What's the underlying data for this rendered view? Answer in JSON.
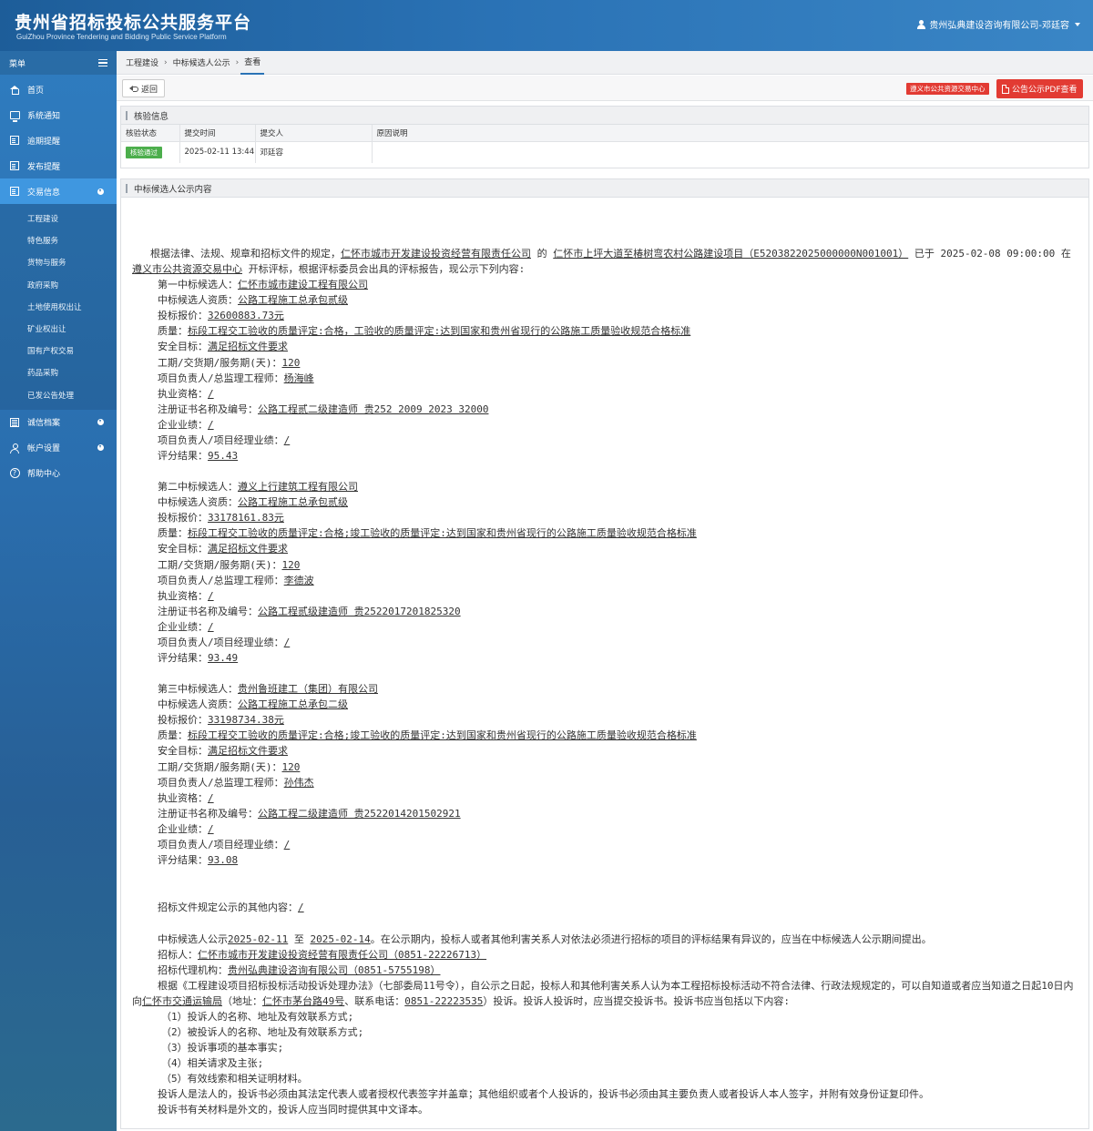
{
  "header": {
    "title": "贵州省招标投标公共服务平台",
    "subtitle": "GuiZhou Province Tendering and Bidding Public Service Platform",
    "user": "贵州弘典建设咨询有限公司-邓廷容"
  },
  "sidebar": {
    "menu_label": "菜单",
    "items": [
      {
        "label": "首页",
        "icon": "home-icon"
      },
      {
        "label": "系统通知",
        "icon": "monitor-icon"
      },
      {
        "label": "逾期提醒",
        "icon": "document-icon"
      },
      {
        "label": "发布提醒",
        "icon": "document-icon"
      },
      {
        "label": "交易信息",
        "icon": "document-icon"
      }
    ],
    "sub_items": [
      "工程建设",
      "特色服务",
      "货物与服务",
      "政府采购",
      "土地使用权出让",
      "矿业权出让",
      "国有产权交易",
      "药品采购",
      "已发公告处理"
    ],
    "lower_items": [
      {
        "label": "诚信档案",
        "icon": "list-icon"
      },
      {
        "label": "帐户设置",
        "icon": "person-icon"
      },
      {
        "label": "帮助中心",
        "icon": "help-icon"
      }
    ]
  },
  "breadcrumb": [
    "工程建设",
    "中标候选人公示",
    "查看"
  ],
  "toolbar": {
    "back_label": "返回",
    "center_label": "遵义市公共资源交易中心",
    "pdf_label": "公告公示PDF查看"
  },
  "verify": {
    "title": "核验信息",
    "columns": [
      "核验状态",
      "提交时间",
      "提交人",
      "原因说明"
    ],
    "row": {
      "status": "核验通过",
      "time": "2025-02-11 13:44",
      "submitter": "邓廷容",
      "reason": ""
    }
  },
  "notice": {
    "title": "中标候选人公示内容",
    "intro_a": "根据法律、法规、规章和招标文件的规定，",
    "tenderer": "仁怀市城市开发建设投资经营有限责任公司",
    "intro_b": "的",
    "project": "仁怀市上坪大道至椿树弯农村公路建设项目（E5203822025000000N001001）",
    "intro_c": "已于",
    "open_time": "2025-02-08 09:00:00",
    "intro_d": "在",
    "venue": "遵义市公共资源交易中心",
    "intro_e": "开标评标，根据评标委员会出具的评标报告，现公示下列内容:",
    "labels": {
      "qualification": "中标候选人资质：",
      "price": "投标报价：",
      "quality": "质量：",
      "safety": "安全目标：",
      "period": "工期/交货期/服务期(天)：",
      "manager": "项目负责人/总监理工程师：",
      "license": "执业资格：",
      "cert": "注册证书名称及编号：",
      "perf": "企业业绩：",
      "mgr_perf": "项目负责人/项目经理业绩：",
      "score": "评分结果："
    },
    "candidates": [
      {
        "rank_label": "第一中标候选人：",
        "name": "仁怀市城市建设工程有限公司",
        "qualification": "公路工程施工总承包贰级",
        "price": "32600883.73元",
        "quality": "标段工程交工验收的质量评定:合格，工验收的质量评定:达到国家和贵州省现行的公路施工质量验收规范合格标准",
        "safety": "满足招标文件要求",
        "period": "120",
        "manager": "杨海峰",
        "license": "/",
        "cert": "公路工程贰二级建造师 贵252 2009 2023 32000",
        "perf": "/",
        "mgr_perf": "/",
        "score": "95.43"
      },
      {
        "rank_label": "第二中标候选人：",
        "name": "遵义上行建筑工程有限公司",
        "qualification": "公路工程施工总承包贰级",
        "price": "33178161.83元",
        "quality": "标段工程交工验收的质量评定:合格;竣工验收的质量评定:达到国家和贵州省现行的公路施工质量验收规范合格标准",
        "safety": "满足招标文件要求",
        "period": "120",
        "manager": "李德波",
        "license": "/",
        "cert": "公路工程贰级建造师 贵2522017201825320",
        "perf": "/",
        "mgr_perf": "/",
        "score": "93.49"
      },
      {
        "rank_label": "第三中标候选人：",
        "name": "贵州鲁班建工（集团）有限公司",
        "qualification": "公路工程施工总承包二级",
        "price": "33198734.38元",
        "quality": "标段工程交工验收的质量评定:合格;竣工验收的质量评定:达到国家和贵州省现行的公路施工质量验收规范合格标准",
        "safety": "满足招标文件要求",
        "period": "120",
        "manager": "孙伟杰",
        "license": "/",
        "cert": "公路工程二级建造师 贵2522014201502921",
        "perf": "/",
        "mgr_perf": "/",
        "score": "93.08"
      }
    ],
    "other_label": "招标文件规定公示的其他内容：",
    "other_value": "/",
    "period_a": "中标候选人公示",
    "period_start": "2025-02-11",
    "period_b": "至",
    "period_end": "2025-02-14",
    "period_c": "。在公示期内，投标人或者其他利害关系人对依法必须进行招标的项目的评标结果有异议的，应当在中标候选人公示期间提出。",
    "tenderer_label": "招标人：",
    "tenderer_value": "仁怀市城市开发建设投资经营有限责任公司（0851-22226713）",
    "agent_label": "招标代理机构：",
    "agent_value": "贵州弘典建设咨询有限公司（0851-5755198）",
    "complaint_a": "根据《工程建设项目招标投标活动投诉处理办法》（七部委局11号令），自公示之日起，投标人和其他利害关系人认为本工程招标投标活动不符合法律、行政法规规定的，可以自知道或者应当知道之日起10日内向",
    "complaint_org": "仁怀市交通运输局",
    "complaint_b": "（地址：",
    "complaint_addr": "仁怀市茅台路49号",
    "complaint_c": "、联系电话：",
    "complaint_phone": "0851-22223535",
    "complaint_d": "）投诉。投诉人投诉时，应当提交投诉书。投诉书应当包括以下内容:",
    "list": [
      "（1）投诉人的名称、地址及有效联系方式;",
      "（2）被投诉人的名称、地址及有效联系方式;",
      "（3）投诉事项的基本事实;",
      "（4）相关请求及主张;",
      "（5）有效线索和相关证明材料。"
    ],
    "closing1": "投诉人是法人的，投诉书必须由其法定代表人或者授权代表签字并盖章；其他组织或者个人投诉的，投诉书必须由其主要负责人或者投诉人本人签字，并附有效身份证复印件。",
    "closing2": "投诉书有关材料是外文的，投诉人应当同时提供其中文译本。"
  }
}
